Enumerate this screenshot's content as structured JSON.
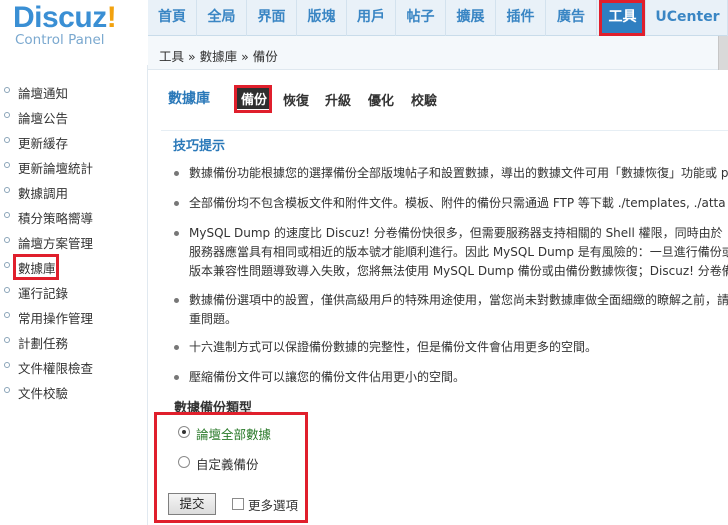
{
  "logo": {
    "brand": "Discuz",
    "bang": "!",
    "subtitle": "Control Panel"
  },
  "nav": {
    "items": [
      {
        "label": "首頁"
      },
      {
        "label": "全局"
      },
      {
        "label": "界面"
      },
      {
        "label": "版塊"
      },
      {
        "label": "用戶"
      },
      {
        "label": "帖子"
      },
      {
        "label": "擴展"
      },
      {
        "label": "插件"
      },
      {
        "label": "廣告"
      },
      {
        "label": "工具"
      },
      {
        "label": "UCenter"
      }
    ],
    "active_label": "工具"
  },
  "breadcrumb": "工具 » 數據庫 » 備份",
  "sidebar": {
    "items": [
      {
        "label": "論壇通知"
      },
      {
        "label": "論壇公告"
      },
      {
        "label": "更新緩存"
      },
      {
        "label": "更新論壇統計"
      },
      {
        "label": "數據調用"
      },
      {
        "label": "積分策略嚮導"
      },
      {
        "label": "論壇方案管理"
      },
      {
        "label": "數據庫"
      },
      {
        "label": "運行記錄"
      },
      {
        "label": "常用操作管理"
      },
      {
        "label": "計劃任務"
      },
      {
        "label": "文件權限檢查"
      },
      {
        "label": "文件校驗"
      }
    ],
    "active_label": "數據庫"
  },
  "main": {
    "title": "數據庫",
    "tabs": [
      {
        "label": "備份"
      },
      {
        "label": "恢復"
      },
      {
        "label": "升級"
      },
      {
        "label": "優化"
      },
      {
        "label": "校驗"
      }
    ],
    "active_tab": "備份",
    "tips_title": "技巧提示",
    "tips": [
      "數據備份功能根據您的選擇備份全部版塊帖子和設置數據，導出的數據文件可用「數據恢復」功能或 p",
      "全部備份均不包含模板文件和附件文件。模板、附件的備份只需通過 FTP 等下載 ./templates, ./atta",
      "MySQL Dump 的速度比 Discuz! 分卷備份快很多，但需要服務器支持相關的 Shell 權限，同時由於",
      "服務器應當具有相同或相近的版本號才能順利進行。因此 MySQL Dump 是有風險的：一旦進行備份或",
      "版本兼容性問題導致導入失敗，您將無法使用 MySQL Dump 備份或由備份數據恢復；Discuz! 分卷備",
      "數據備份選項中的設置，僅供高級用戶的特殊用途使用，當您尚未對數據庫做全面細緻的瞭解之前，請",
      "重問題。",
      "十六進制方式可以保證備份數據的完整性，但是備份文件會佔用更多的空間。",
      "壓縮備份文件可以讓您的備份文件佔用更小的空間。"
    ],
    "backup_type_title": "數據備份類型",
    "options": [
      {
        "label": "論壇全部數據",
        "checked": true
      },
      {
        "label": "自定義備份",
        "checked": false
      }
    ],
    "submit_label": "提交",
    "more_options_label": "更多選項"
  }
}
